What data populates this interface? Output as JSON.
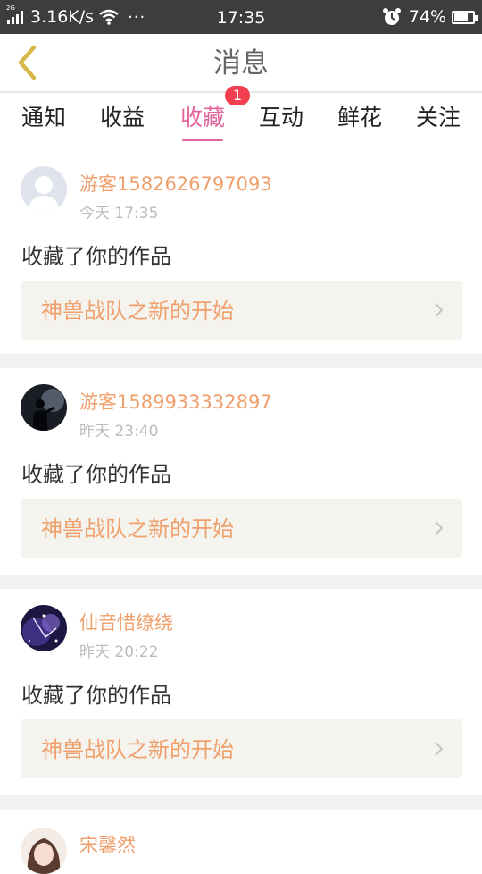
{
  "status_bar": {
    "network_tag": "2G",
    "speed": "3.16K/s",
    "more": "···",
    "time": "17:35",
    "battery": "74%",
    "battery_level": 0.74
  },
  "header": {
    "title": "消息"
  },
  "tabs": [
    {
      "label": "通知"
    },
    {
      "label": "收益"
    },
    {
      "label": "收藏",
      "badge": "1",
      "active": true
    },
    {
      "label": "互动"
    },
    {
      "label": "鲜花"
    },
    {
      "label": "关注"
    }
  ],
  "messages": [
    {
      "username": "游客1582626797093",
      "time": "今天 17:35",
      "action": "收藏了你的作品",
      "work_title": "神兽战队之新的开始",
      "avatar_icon": "default-user-avatar"
    },
    {
      "username": "游客1589933332897",
      "time": "昨天 23:40",
      "action": "收藏了你的作品",
      "work_title": "神兽战队之新的开始",
      "avatar_icon": "silhouette-avatar"
    },
    {
      "username": "仙音惜缭绕",
      "time": "昨天 20:22",
      "action": "收藏了你的作品",
      "work_title": "神兽战队之新的开始",
      "avatar_icon": "galaxy-avatar"
    },
    {
      "username": "宋馨然",
      "avatar_icon": "girl-avatar"
    }
  ],
  "colors": {
    "accent": "#e2649b",
    "username": "#f0a06c",
    "badge": "#f23f4f",
    "back_arrow": "#d8b84a"
  }
}
